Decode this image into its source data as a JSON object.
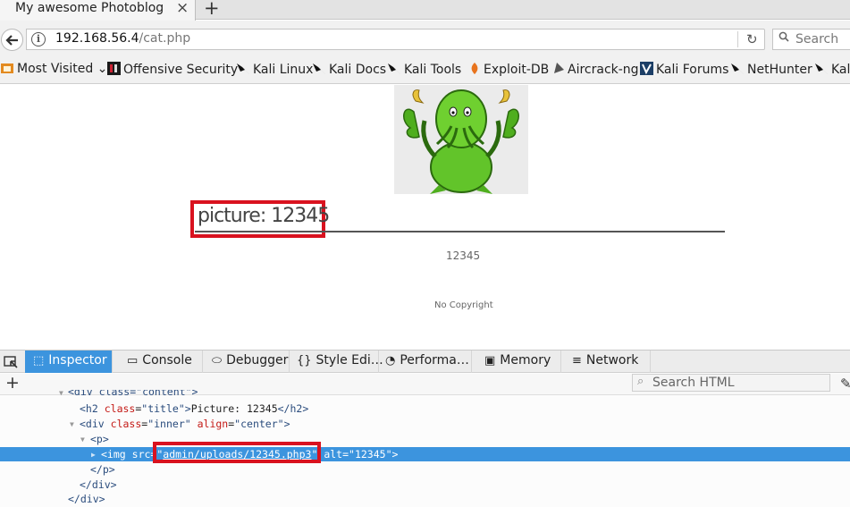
{
  "browser": {
    "tab_title": "My awesome Photoblog",
    "url_host": "192.168.56.4",
    "url_path": "/cat.php",
    "search_placeholder": "Search"
  },
  "bookmarks": [
    {
      "label": "Most Visited",
      "icon": "most-visited-icon"
    },
    {
      "label": "Offensive Security",
      "icon": "offsec-icon"
    },
    {
      "label": "Kali Linux",
      "icon": "kali-dragon-icon"
    },
    {
      "label": "Kali Docs",
      "icon": "kali-dragon-icon"
    },
    {
      "label": "Kali Tools",
      "icon": "kali-dragon-icon"
    },
    {
      "label": "Exploit-DB",
      "icon": "exploit-db-icon"
    },
    {
      "label": "Aircrack-ng",
      "icon": "aircrack-icon"
    },
    {
      "label": "Kali Forums",
      "icon": "kali-forums-icon"
    },
    {
      "label": "NetHunter",
      "icon": "kali-dragon-icon"
    },
    {
      "label": "Kal",
      "icon": "kali-dragon-icon"
    }
  ],
  "page": {
    "title": "picture: 12345",
    "description": "12345",
    "footer": "No Copyright"
  },
  "devtools": {
    "tabs": [
      {
        "label": "Inspector",
        "icon": "inspector-icon",
        "active": true
      },
      {
        "label": "Console",
        "icon": "console-icon"
      },
      {
        "label": "Debugger",
        "icon": "debugger-icon"
      },
      {
        "label": "Style Edi…",
        "icon": "style-editor-icon"
      },
      {
        "label": "Performa…",
        "icon": "performance-icon"
      },
      {
        "label": "Memory",
        "icon": "memory-icon"
      },
      {
        "label": "Network",
        "icon": "network-icon"
      }
    ],
    "search_placeholder": "Search HTML",
    "markup": {
      "line0": "<div class=\"content\">",
      "h2_open": "<h2",
      "h2_attr": "class",
      "h2_val": "\"title\"",
      "h2_text": "Picture: 12345",
      "h2_close": "</h2>",
      "div_open": "<div",
      "div_attr1": "class",
      "div_val1": "\"inner\"",
      "div_attr2": "align",
      "div_val2": "\"center\"",
      "div_end": ">",
      "p_open": "<p>",
      "img_open": "<img",
      "img_src_attr": "src=",
      "img_src": "admin/uploads/12345.php3",
      "img_alt_attr": "alt=",
      "img_alt": "\"12345\"",
      "img_close": ">",
      "p_close": "</p>",
      "div_close1": "</div>",
      "div_close2": "</div>"
    }
  }
}
